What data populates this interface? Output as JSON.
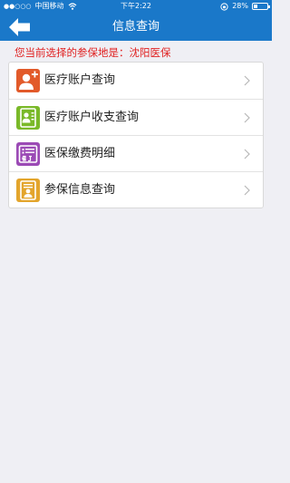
{
  "status_bar": {
    "carrier": "中国移动",
    "time": "下午2:22",
    "battery": "28%",
    "battery_level": 0.28
  },
  "nav": {
    "title": "信息查询",
    "back_icon": "arrow-left-icon"
  },
  "notice": "您当前选择的参保地是：沈阳医保",
  "menu": [
    {
      "label": "医疗账户查询",
      "icon": "medical-account-icon",
      "color": "#e25a2a"
    },
    {
      "label": "医疗账户收支查询",
      "icon": "income-expense-icon",
      "color": "#7ab929"
    },
    {
      "label": "医保缴费明细",
      "icon": "payment-detail-icon",
      "color": "#9b4ab5"
    },
    {
      "label": "参保信息查询",
      "icon": "insurance-info-icon",
      "color": "#e3a52c"
    }
  ],
  "colors": {
    "header": "#1a78c9",
    "notice": "#e02020",
    "background": "#efeff4"
  }
}
